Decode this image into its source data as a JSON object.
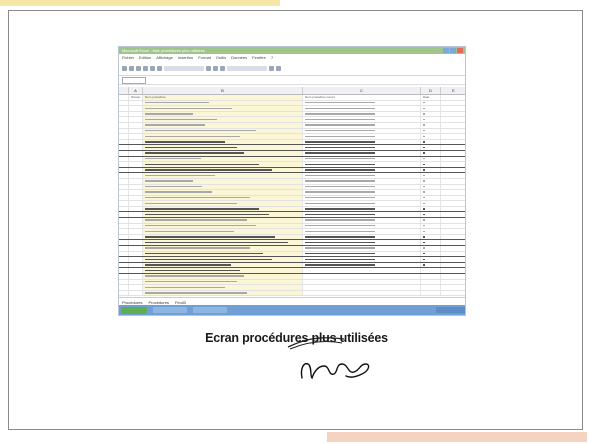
{
  "caption": "Ecran procédures plus utilisées",
  "window": {
    "title": "Microsoft Excel - liste procédures plus utilisées",
    "menus": [
      "Fichier",
      "Edition",
      "Affichage",
      "Insertion",
      "Format",
      "Outils",
      "Données",
      "Fenêtre",
      "?"
    ],
    "columns": [
      "",
      "A",
      "B",
      "C",
      "D",
      "E"
    ],
    "col_labels": {
      "a": "Niveau",
      "b": "Nom procédure",
      "c": "Nom procédure compl.",
      "d": "Date"
    },
    "sheet_tabs": [
      "Procédures",
      "Procédures",
      "Feuil3"
    ]
  },
  "colors": {
    "title_bar": "#9fc58a",
    "highlight_col": "#fbf7d6",
    "taskbar": "#6f9fd4"
  },
  "icons": [
    "window-min-icon",
    "window-max-icon",
    "close-icon",
    "start-button-icon",
    "signature-mark"
  ]
}
